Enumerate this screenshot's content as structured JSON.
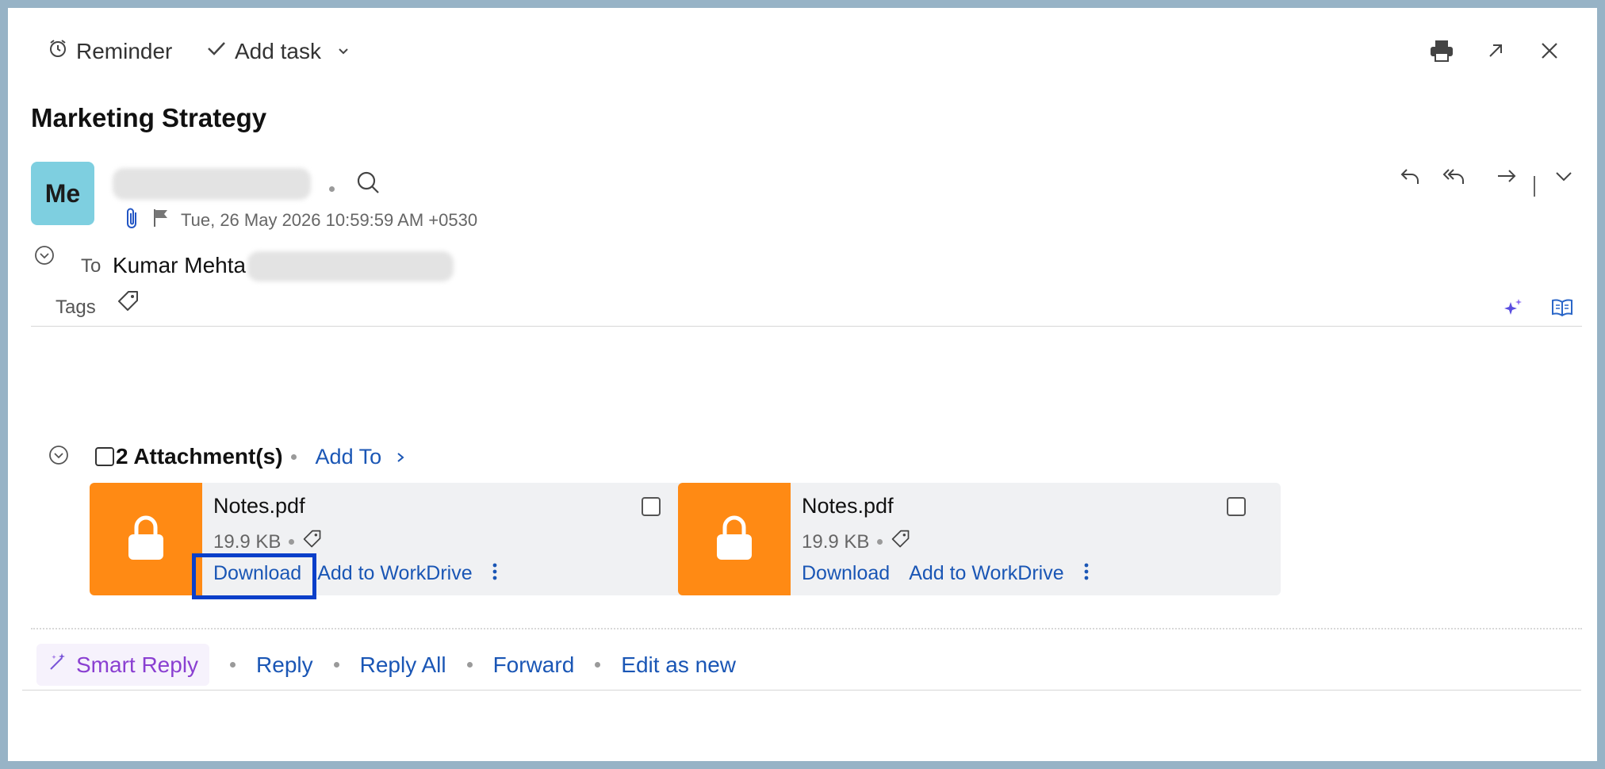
{
  "toolbar": {
    "reminder_label": "Reminder",
    "add_task_label": "Add task"
  },
  "email": {
    "subject": "Marketing Strategy",
    "avatar_initials": "Me",
    "timestamp": "Tue, 26 May 2026 10:59:59 AM +0530",
    "to_label": "To",
    "to_name": "Kumar Mehta",
    "tags_label": "Tags"
  },
  "attachments": {
    "count_label": "2 Attachment(s)",
    "add_to_label": "Add To",
    "items": [
      {
        "name": "Notes.pdf",
        "size": "19.9 KB",
        "download": "Download",
        "workdrive": "Add to WorkDrive"
      },
      {
        "name": "Notes.pdf",
        "size": "19.9 KB",
        "download": "Download",
        "workdrive": "Add to WorkDrive"
      }
    ]
  },
  "reply_bar": {
    "smart_reply": "Smart Reply",
    "reply": "Reply",
    "reply_all": "Reply All",
    "forward": "Forward",
    "edit_as_new": "Edit as new"
  },
  "colors": {
    "accent": "#1a56b5",
    "avatar_bg": "#7ecfe0",
    "attachment_thumb": "#ff8a14",
    "highlight": "#0a3fc9",
    "smart_reply": "#8a3fd1"
  },
  "icons": [
    "alarm-clock-icon",
    "checkmark-icon",
    "chevron-down-icon",
    "print-icon",
    "expand-icon",
    "close-icon",
    "search-icon",
    "paperclip-icon",
    "flag-icon",
    "reply-icon",
    "reply-all-icon",
    "forward-icon",
    "tag-icon",
    "sparkle-icon",
    "book-icon",
    "lock-icon",
    "more-vertical-icon"
  ]
}
